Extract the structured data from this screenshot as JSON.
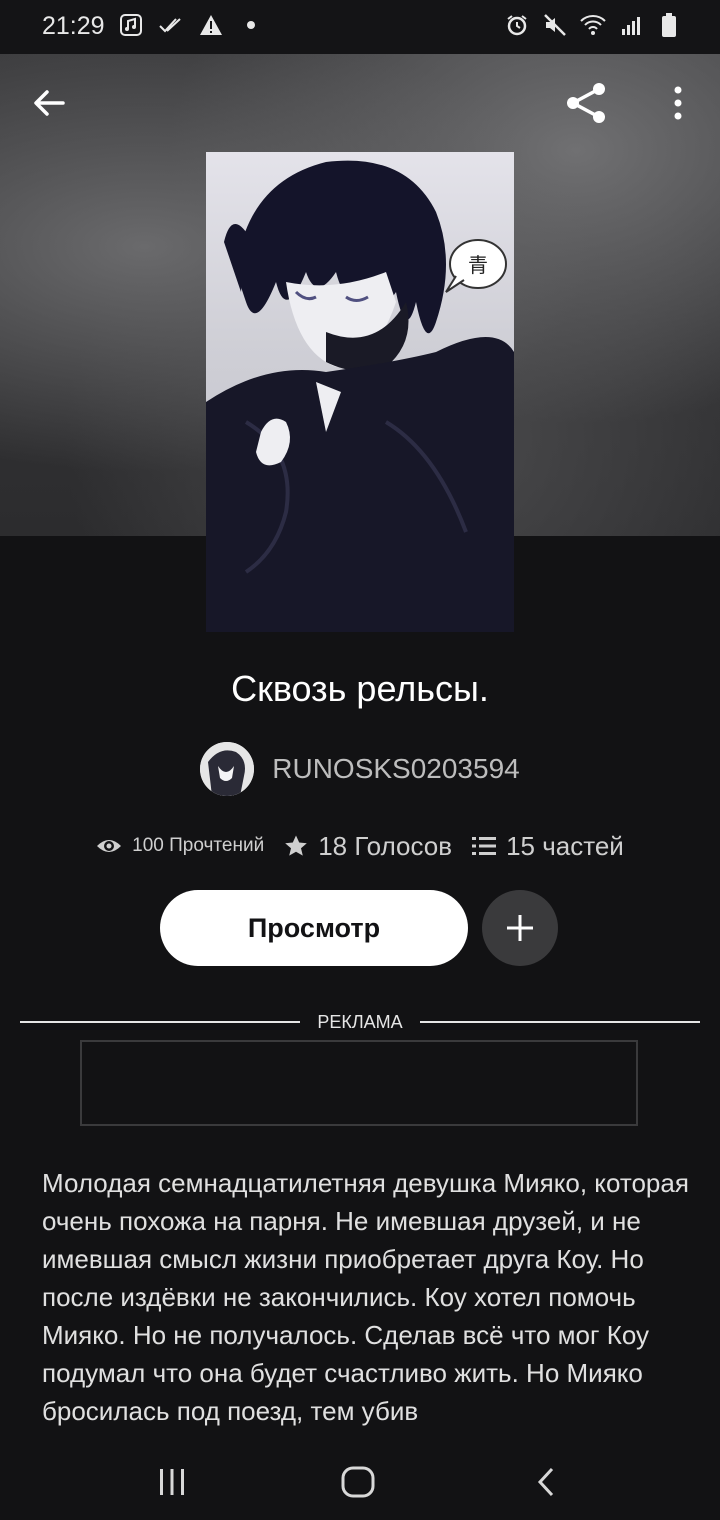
{
  "status_bar": {
    "time": "21:29",
    "left_icons": [
      "music-note-icon",
      "double-check-icon",
      "warning-icon",
      "dot-icon"
    ],
    "right_icons": [
      "alarm-icon",
      "mute-icon",
      "wifi-icon",
      "signal-icon",
      "battery-icon"
    ]
  },
  "top_bar": {
    "back_icon": "arrow-left-icon",
    "share_icon": "share-icon",
    "menu_icon": "more-vertical-icon"
  },
  "story": {
    "title": "Сквозь рельсы.",
    "author": "RUNOSKS0203594",
    "stats": {
      "reads": "100 Прочтений",
      "votes": "18 Голосов",
      "parts": "15 частей"
    },
    "view_button_label": "Просмотр",
    "description": "Молодая семнадцатилетняя девушка Мияко, которая очень похожа на парня. Не имевшая друзей, и не имевшая смысл жизни приобретает друга Коу. Но после издёвки не закончились. Коу хотел помочь Мияко. Но не получалось. Сделав всё что мог Коу подумал что она будет счастливо жить. Но Мияко бросилась под поезд, тем убив"
  },
  "cover_badge_text": "青",
  "ad": {
    "label": "РЕКЛАМА"
  },
  "nav_bar": {
    "recents_icon": "recents-icon",
    "home_icon": "home-icon",
    "back_icon": "back-chevron-icon"
  }
}
